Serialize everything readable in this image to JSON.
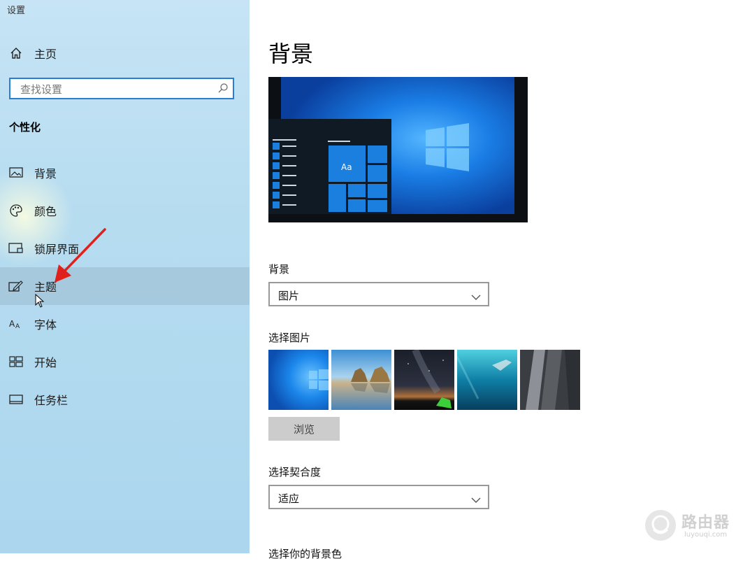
{
  "window": {
    "title": "设置"
  },
  "sidebar": {
    "home_label": "主页",
    "search_placeholder": "查找设置",
    "section_title": "个性化",
    "items": [
      {
        "label": "背景",
        "icon": "picture-icon"
      },
      {
        "label": "颜色",
        "icon": "palette-icon"
      },
      {
        "label": "锁屏界面",
        "icon": "lock-screen-icon"
      },
      {
        "label": "主题",
        "icon": "theme-icon"
      },
      {
        "label": "字体",
        "icon": "font-icon"
      },
      {
        "label": "开始",
        "icon": "start-icon"
      },
      {
        "label": "任务栏",
        "icon": "taskbar-icon"
      }
    ],
    "selected": "主题"
  },
  "main": {
    "title": "背景",
    "preview_tile_text": "Aa",
    "background_label": "背景",
    "background_value": "图片",
    "choose_picture_label": "选择图片",
    "browse_label": "浏览",
    "fit_label": "选择契合度",
    "fit_value": "适应",
    "next_label": "选择你的背景色"
  },
  "watermark": {
    "text": "路由器",
    "url": "luyouqi.com"
  },
  "colors": {
    "accent": "#0078d7",
    "sidebar_bg": "#b6dcf0",
    "arrow": "#e0201b"
  }
}
